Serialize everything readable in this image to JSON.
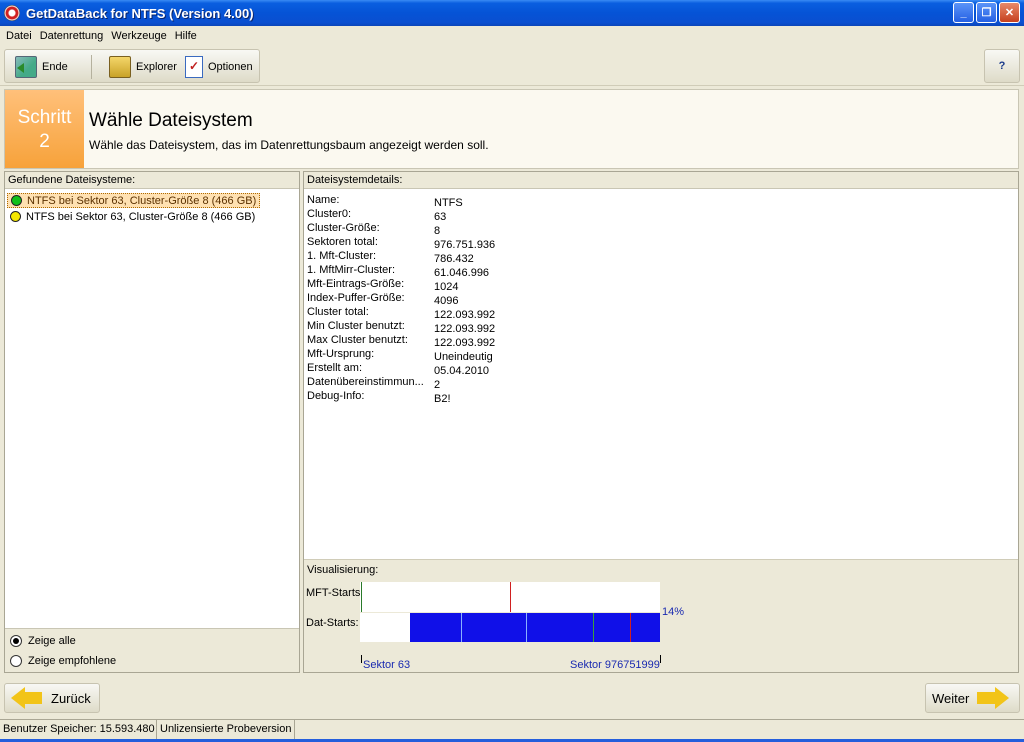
{
  "window": {
    "title": "GetDataBack for NTFS (Version 4.00)",
    "min": "_",
    "max": "❐",
    "close": "✕"
  },
  "menu": {
    "items": [
      "Datei",
      "Datenrettung",
      "Werkzeuge",
      "Hilfe"
    ]
  },
  "toolbar": {
    "end_label": "Ende",
    "explorer_label": "Explorer",
    "options_label": "Optionen",
    "help_label": "?"
  },
  "step": {
    "word": "Schritt",
    "number": "2",
    "title": "Wähle Dateisystem",
    "description": "Wähle das Dateisystem, das im Datenrettungsbaum angezeigt werden soll."
  },
  "left": {
    "header": "Gefundene Dateisysteme:",
    "items": [
      {
        "label": "NTFS bei Sektor 63, Cluster-Größe 8 (466 GB)",
        "status_color": "#12c01a",
        "selected": true
      },
      {
        "label": "NTFS bei Sektor 63, Cluster-Größe 8 (466 GB)",
        "status_color": "#f4e600",
        "selected": false
      }
    ],
    "radio_all": "Zeige alle",
    "radio_recommended": "Zeige empfohlene",
    "radio_selected": "all"
  },
  "details": {
    "header": "Dateisystemdetails:",
    "rows": [
      {
        "label": "Name:",
        "value": "NTFS"
      },
      {
        "label": "Cluster0:",
        "value": "63"
      },
      {
        "label": "Cluster-Größe:",
        "value": "8"
      },
      {
        "label": "Sektoren total:",
        "value": "976.751.936"
      },
      {
        "label": "1. Mft-Cluster:",
        "value": "786.432"
      },
      {
        "label": "1. MftMirr-Cluster:",
        "value": "61.046.996"
      },
      {
        "label": "Mft-Eintrags-Größe:",
        "value": "1024"
      },
      {
        "label": "Index-Puffer-Größe:",
        "value": "4096"
      },
      {
        "label": "Cluster total:",
        "value": "122.093.992"
      },
      {
        "label": "Min Cluster benutzt:",
        "value": "122.093.992"
      },
      {
        "label": "Max Cluster benutzt:",
        "value": "122.093.992"
      },
      {
        "label": "Mft-Ursprung:",
        "value": "Uneindeutig"
      },
      {
        "label": "Erstellt am:",
        "value": "05.04.2010"
      },
      {
        "label": "Datenübereinstimmun...",
        "value": "2"
      },
      {
        "label": "Debug-Info:",
        "value": "B2!"
      }
    ]
  },
  "visualization": {
    "label": "Visualisierung:",
    "mft_label": "MFT-Starts",
    "dat_label": "Dat-Starts:",
    "percent": "14%",
    "sector_start": "Sektor 63",
    "sector_end": "Sektor 976751999"
  },
  "nav": {
    "back_label": "Zurück",
    "next_label": "Weiter"
  },
  "status": {
    "memory": "Benutzer Speicher: 15.593.480",
    "license": "Unlizensierte Probeversion"
  },
  "colors": {
    "accent_step": "#f7a23a",
    "selection_bg": "#ffe1b2",
    "vis_blue": "#1010e8",
    "link_blue": "#1a2ab0"
  }
}
